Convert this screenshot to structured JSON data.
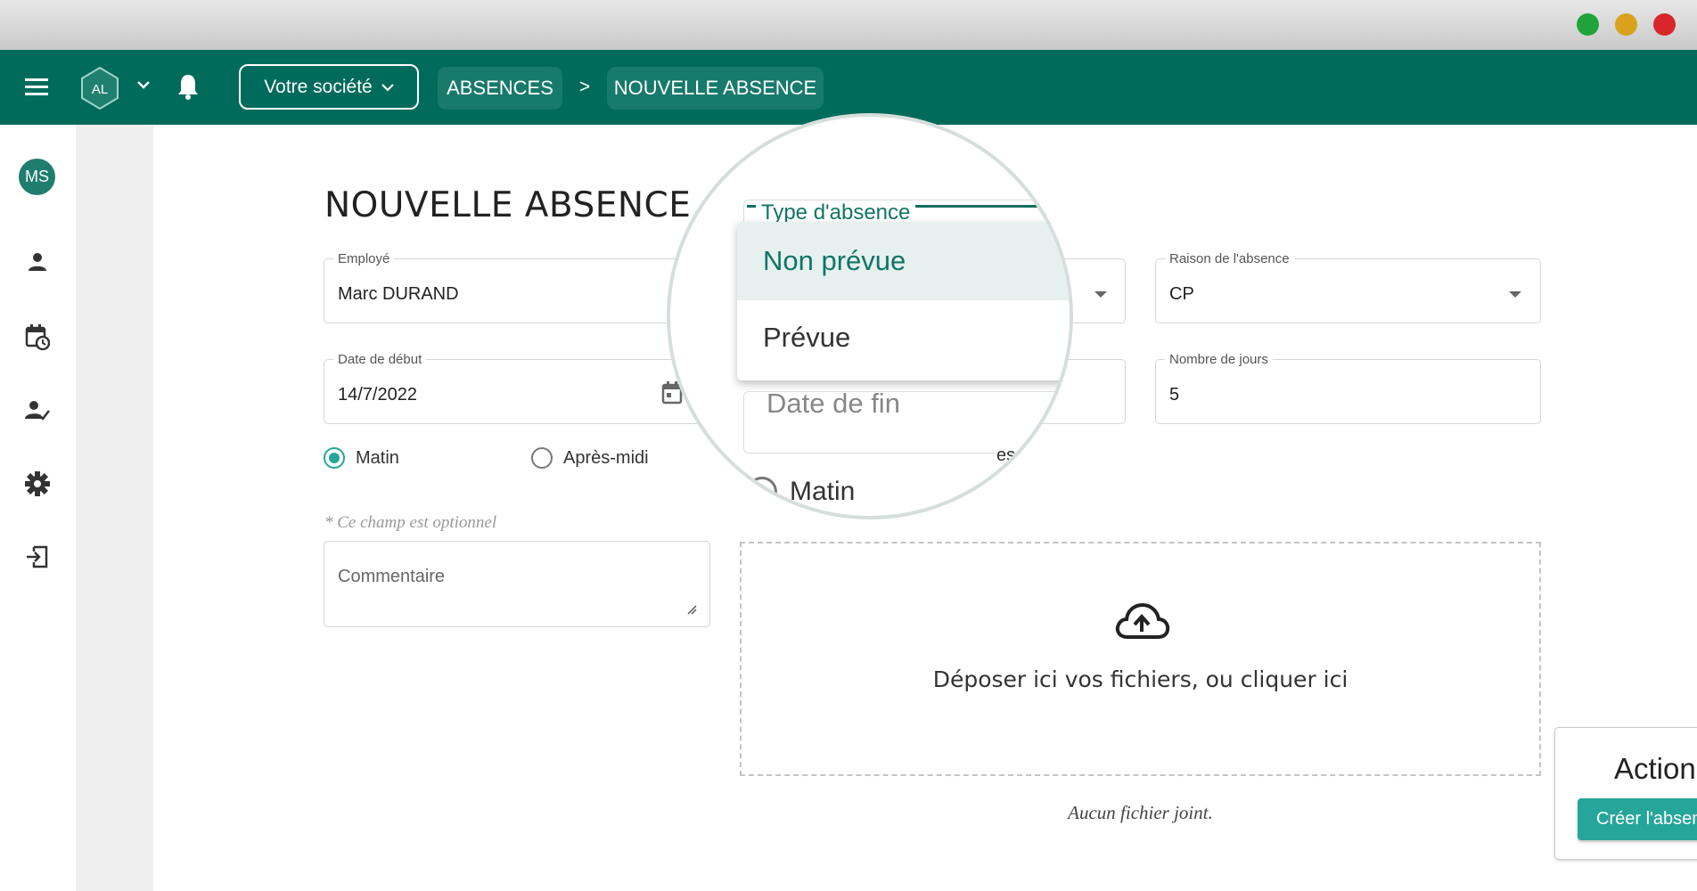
{
  "window": {
    "controls": [
      "maximize",
      "minimize",
      "close"
    ],
    "colors": {
      "green": "#1fa33a",
      "yellow": "#d9a21c",
      "red": "#d8262b"
    }
  },
  "header": {
    "menu_icon": "hamburger-icon",
    "logo_text": "AL",
    "company_button": "Votre société",
    "breadcrumb": [
      "ABSENCES",
      ">",
      "NOUVELLE ABSENCE"
    ],
    "color": "#006b5b"
  },
  "sidebar": {
    "avatar": "MS",
    "items": [
      "person-icon",
      "calendar-clock-icon",
      "person-check-icon",
      "gear-icon",
      "logout-icon"
    ]
  },
  "form": {
    "title": "NOUVELLE ABSENCE",
    "employee": {
      "label": "Employé",
      "value": "Marc DURAND"
    },
    "type": {
      "label": "Type d'absence",
      "options": [
        "Non prévue",
        "Prévue"
      ],
      "highlighted": "Non prévue"
    },
    "reason": {
      "label": "Raison de l'absence",
      "value": "CP"
    },
    "start_date": {
      "label": "Date de début",
      "value": "14/7/2022"
    },
    "end_date": {
      "placeholder": "Date de fin"
    },
    "days": {
      "label": "Nombre de jours",
      "value": "5"
    },
    "start_period": {
      "options": [
        "Matin",
        "Après-midi"
      ],
      "selected": "Matin"
    },
    "end_period": {
      "options": [
        "Matin",
        "es-midi"
      ]
    },
    "optional_note": "* Ce champ est optionnel",
    "comment_placeholder": "Commentaire",
    "dropzone": "Déposer ici vos fichiers, ou cliquer ici",
    "no_file": "Aucun fichier joint."
  },
  "action": {
    "title": "Action",
    "create_button": "Créer l'absence",
    "accent": "#26a69a"
  }
}
